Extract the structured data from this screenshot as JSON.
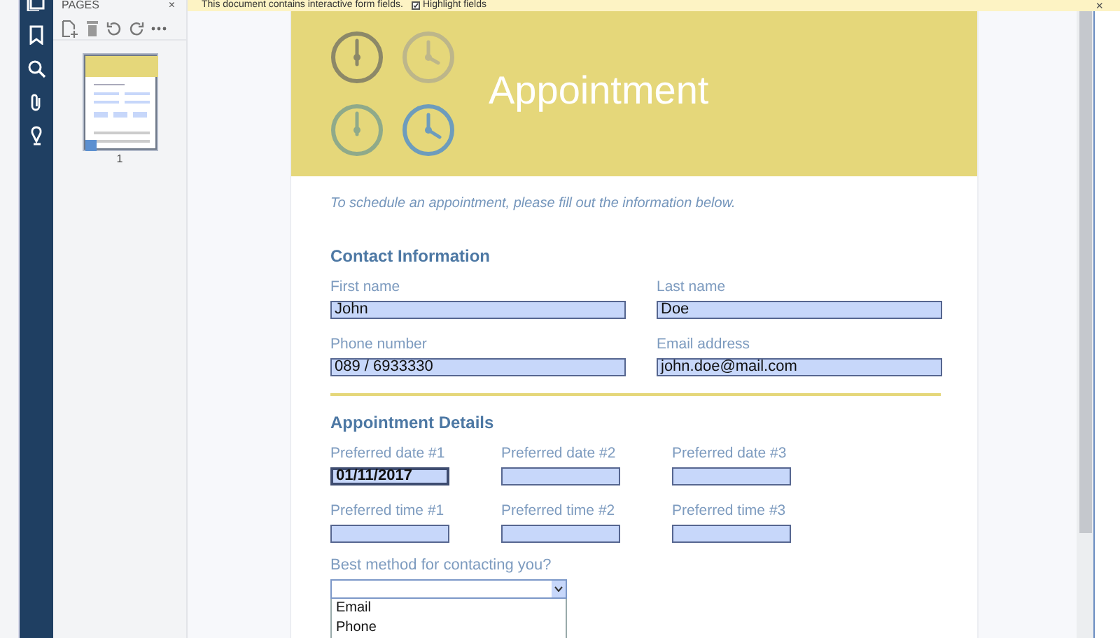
{
  "pages_panel": {
    "title": "PAGES",
    "close": "×",
    "thumbnails": [
      {
        "label": "1",
        "selected": true
      }
    ]
  },
  "notification": {
    "text": "This document contains interactive form fields.",
    "highlight_fields": {
      "label": "Highlight fields",
      "checked": true
    },
    "close": "×"
  },
  "document": {
    "title": "Appointment",
    "intro": "To schedule an appointment, please fill out the information below.",
    "sections": [
      {
        "heading": "Contact Information",
        "fields": [
          {
            "label": "First name",
            "value": "John",
            "focused": false
          },
          {
            "label": "Last name",
            "value": "Doe",
            "focused": false
          },
          {
            "label": "Phone number",
            "value": "089 / 6933330",
            "focused": false
          },
          {
            "label": "Email address",
            "value": "john.doe@mail.com",
            "focused": false
          }
        ]
      },
      {
        "heading": "Appointment Details",
        "fields": [
          {
            "label": "Preferred date #1",
            "value": "01/11/2017",
            "focused": true
          },
          {
            "label": "Preferred date #2",
            "focused": false
          },
          {
            "label": "Preferred date #3",
            "focused": false
          },
          {
            "label": "Preferred time #1",
            "focused": false
          },
          {
            "label": "Preferred time #2",
            "focused": false
          },
          {
            "label": "Preferred time #3",
            "focused": false
          }
        ]
      }
    ],
    "dropdown": {
      "label": "Best method for contacting you?",
      "expanded": true,
      "options": [
        "Email",
        "Phone"
      ]
    }
  }
}
